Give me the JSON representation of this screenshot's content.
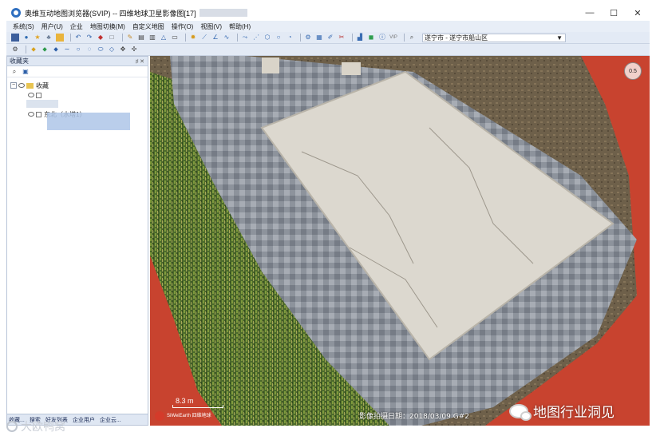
{
  "window": {
    "title": "奥维互动地图浏览器(SVIP) -- 四维地球卫星影像图[17]",
    "controls": {
      "minimize": "—",
      "maximize": "☐",
      "close": "✕"
    }
  },
  "menu": {
    "items": [
      "系统(S)",
      "用户(U)",
      "企业",
      "地图切换(M)",
      "自定义地图",
      "操作(O)",
      "视图(V)",
      "帮助(H)"
    ]
  },
  "toolbar": {
    "location_text": "遂宁市 - 遂宁市船山区"
  },
  "left_panel": {
    "title": "收藏夹",
    "pin": "♯ ✕",
    "tree": {
      "root_label": "收藏",
      "item_label": "东北（水塔1）"
    },
    "bottom_tabs": [
      "收藏...",
      "搜索",
      "好友列表",
      "企业用户",
      "企业云..."
    ]
  },
  "map": {
    "compass_label": "0.5",
    "scale_label": "8.3 m",
    "logo_text": "SiWeiEarth 四维地球",
    "capture_date": "影像拍摄日期：2018/03/09 G#2"
  },
  "watermarks": {
    "right": "地图行业洞见",
    "left": "大欧鸭窝"
  },
  "colors": {
    "menubar": "#e8eef7",
    "toolbar": "#e3eaf5",
    "track_red": "#c8432f",
    "grass": "#4d6a2c",
    "roof": "#dcd8cf"
  }
}
